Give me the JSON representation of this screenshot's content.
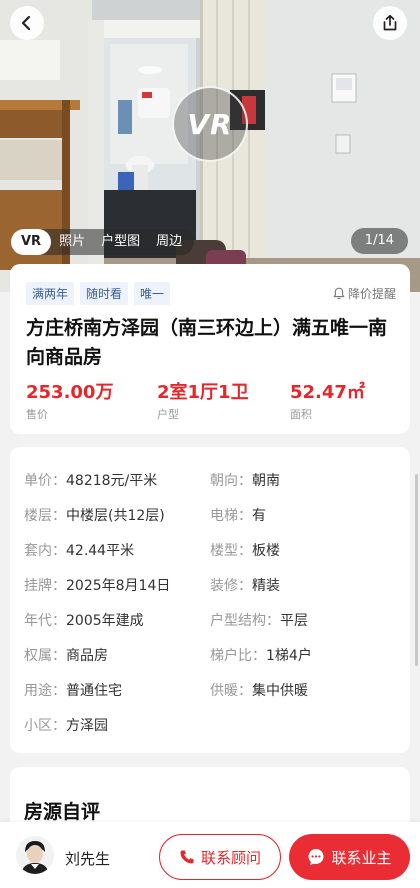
{
  "hero": {
    "vr_badge": "VR",
    "tabs": [
      "VR",
      "照片",
      "户型图",
      "周边"
    ],
    "counter": "1/14",
    "icons": [
      "back-arrow-icon",
      "share-icon"
    ]
  },
  "summary": {
    "tags": [
      "满两年",
      "随时看",
      "唯一"
    ],
    "alert_label": "降价提醒",
    "title": "方庄桥南方泽园（南三环边上）满五唯一南向商品房",
    "stats": [
      {
        "value": "253.00万",
        "label": "售价"
      },
      {
        "value": "2室1厅1卫",
        "label": "户型"
      },
      {
        "value": "52.47㎡",
        "label": "面积"
      }
    ]
  },
  "attributes": [
    {
      "key": "单价：",
      "value": "48218元/平米"
    },
    {
      "key": "朝向：",
      "value": "朝南"
    },
    {
      "key": "楼层：",
      "value": "中楼层(共12层)"
    },
    {
      "key": "电梯：",
      "value": "有"
    },
    {
      "key": "套内：",
      "value": "42.44平米"
    },
    {
      "key": "楼型：",
      "value": "板楼"
    },
    {
      "key": "挂牌：",
      "value": "2025年8月14日"
    },
    {
      "key": "装修：",
      "value": "精装"
    },
    {
      "key": "年代：",
      "value": "2005年建成"
    },
    {
      "key": "户型结构：",
      "value": "平层"
    },
    {
      "key": "权属：",
      "value": "商品房"
    },
    {
      "key": "梯户比：",
      "value": "1梯4户"
    },
    {
      "key": "用途：",
      "value": "普通住宅"
    },
    {
      "key": "供暖：",
      "value": "集中供暖"
    },
    {
      "key": "小区：",
      "value": "方泽园"
    }
  ],
  "review": {
    "title": "房源自评"
  },
  "bottom_bar": {
    "agent_name": "刘先生",
    "consult_label": "联系顾问",
    "owner_label": "联系业主"
  },
  "colors": {
    "accent": "#e5272c",
    "tag_bg": "#eef3fb",
    "tag_text": "#3b5c94"
  }
}
